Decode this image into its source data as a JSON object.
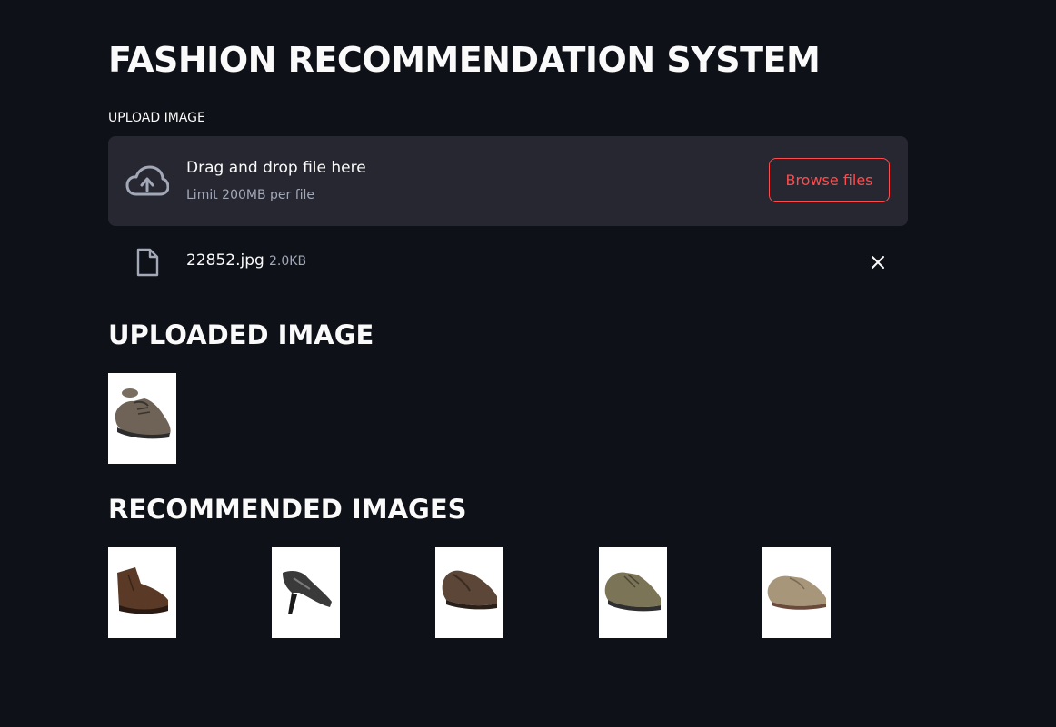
{
  "app": {
    "title": "FASHION RECOMMENDATION SYSTEM"
  },
  "uploader": {
    "label": "UPLOAD IMAGE",
    "drop_text": "Drag and drop file here",
    "limit_text": "Limit 200MB per file",
    "browse_label": "Browse files",
    "icon": "cloud-upload-icon"
  },
  "file": {
    "name": "22852.jpg",
    "size": "2.0KB",
    "icon": "file-icon",
    "remove_icon": "close-icon"
  },
  "uploaded": {
    "heading": "UPLOADED IMAGE",
    "image": {
      "description": "brown lace-up casual shoe"
    }
  },
  "recommended": {
    "heading": "RECOMMENDED IMAGES",
    "images": [
      {
        "description": "dark brown leather ankle boot"
      },
      {
        "description": "black high-heel pump"
      },
      {
        "description": "brown leather casual shoe"
      },
      {
        "description": "olive lace-up sneaker"
      },
      {
        "description": "tan suede casual shoe"
      }
    ]
  },
  "colors": {
    "background": "#0e1117",
    "panel": "#262730",
    "accent": "#ff4b4b",
    "text": "#fafafa",
    "muted": "#a3a8b8"
  }
}
